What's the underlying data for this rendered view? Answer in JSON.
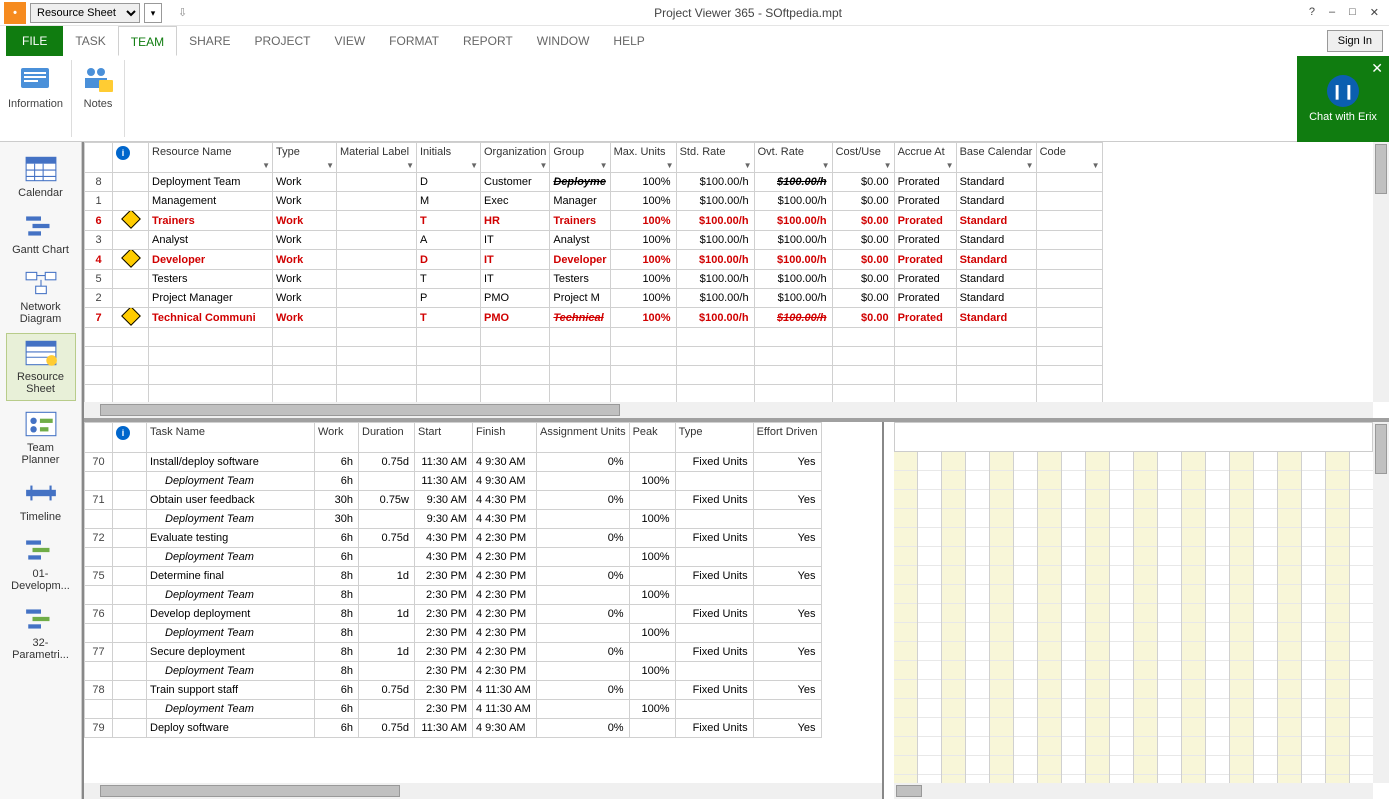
{
  "titlebar": {
    "dropdown": "Resource Sheet",
    "title": "Project Viewer 365 - SOftpedia.mpt",
    "help": "?",
    "min": "–",
    "max": "□",
    "close": "✕"
  },
  "tabs": [
    "FILE",
    "TASK",
    "TEAM",
    "SHARE",
    "PROJECT",
    "VIEW",
    "FORMAT",
    "REPORT",
    "WINDOW",
    "HELP"
  ],
  "signin": "Sign In",
  "ribbon": {
    "information": "Information",
    "notes": "Notes"
  },
  "chat": {
    "label": "Chat with Erix",
    "close": "✕",
    "face": "❙❙"
  },
  "sidebar": [
    {
      "id": "calendar",
      "label": "Calendar"
    },
    {
      "id": "gantt",
      "label": "Gantt Chart"
    },
    {
      "id": "network",
      "label": "Network Diagram"
    },
    {
      "id": "resource",
      "label": "Resource Sheet",
      "sel": true
    },
    {
      "id": "team",
      "label": "Team Planner"
    },
    {
      "id": "timeline",
      "label": "Timeline"
    },
    {
      "id": "dev",
      "label": "01-Developm..."
    },
    {
      "id": "param",
      "label": "32-Parametri..."
    }
  ],
  "resCols": [
    "",
    "",
    "Resource Name",
    "Type",
    "Material Label",
    "Initials",
    "Organization",
    "Group",
    "Max. Units",
    "Std. Rate",
    "Ovt. Rate",
    "Cost/Use",
    "Accrue At",
    "Base Calendar",
    "Code"
  ],
  "resources": [
    {
      "row": "8",
      "ind": "",
      "name": "Deployment Team",
      "type": "Work",
      "mat": "",
      "init": "D",
      "org": "Customer",
      "group": "Deployme",
      "grpStrike": true,
      "max": "100%",
      "std": "$100.00/h",
      "ovt": "$100.00/h",
      "ovtStrike": true,
      "cost": "$0.00",
      "acc": "Prorated",
      "cal": "Standard",
      "red": false
    },
    {
      "row": "1",
      "ind": "",
      "name": "Management",
      "type": "Work",
      "mat": "",
      "init": "M",
      "org": "Exec",
      "group": "Manager",
      "max": "100%",
      "std": "$100.00/h",
      "ovt": "$100.00/h",
      "cost": "$0.00",
      "acc": "Prorated",
      "cal": "Standard",
      "red": false
    },
    {
      "row": "6",
      "ind": "y",
      "name": "Trainers",
      "type": "Work",
      "mat": "",
      "init": "T",
      "org": "HR",
      "group": "Trainers",
      "max": "100%",
      "std": "$100.00/h",
      "ovt": "$100.00/h",
      "cost": "$0.00",
      "acc": "Prorated",
      "cal": "Standard",
      "red": true
    },
    {
      "row": "3",
      "ind": "",
      "name": "Analyst",
      "type": "Work",
      "mat": "",
      "init": "A",
      "org": "IT",
      "group": "Analyst",
      "max": "100%",
      "std": "$100.00/h",
      "ovt": "$100.00/h",
      "cost": "$0.00",
      "acc": "Prorated",
      "cal": "Standard",
      "red": false
    },
    {
      "row": "4",
      "ind": "y",
      "name": "Developer",
      "type": "Work",
      "mat": "",
      "init": "D",
      "org": "IT",
      "group": "Developer",
      "max": "100%",
      "std": "$100.00/h",
      "ovt": "$100.00/h",
      "cost": "$0.00",
      "acc": "Prorated",
      "cal": "Standard",
      "red": true
    },
    {
      "row": "5",
      "ind": "",
      "name": "Testers",
      "type": "Work",
      "mat": "",
      "init": "T",
      "org": "IT",
      "group": "Testers",
      "max": "100%",
      "std": "$100.00/h",
      "ovt": "$100.00/h",
      "cost": "$0.00",
      "acc": "Prorated",
      "cal": "Standard",
      "red": false
    },
    {
      "row": "2",
      "ind": "",
      "name": "Project Manager",
      "type": "Work",
      "mat": "",
      "init": "P",
      "org": "PMO",
      "group": "Project M",
      "max": "100%",
      "std": "$100.00/h",
      "ovt": "$100.00/h",
      "cost": "$0.00",
      "acc": "Prorated",
      "cal": "Standard",
      "red": false
    },
    {
      "row": "7",
      "ind": "y",
      "name": "Technical Communi",
      "type": "Work",
      "mat": "",
      "init": "T",
      "org": "PMO",
      "group": "Technical",
      "grpStrike": true,
      "max": "100%",
      "std": "$100.00/h",
      "ovt": "$100.00/h",
      "ovtStrike": true,
      "cost": "$0.00",
      "acc": "Prorated",
      "cal": "Standard",
      "red": true
    }
  ],
  "taskCols": [
    "",
    "",
    "Task Name",
    "Work",
    "Duration",
    "Start",
    "Finish",
    "Assignment Units",
    "Peak",
    "Type",
    "Effort Driven"
  ],
  "tasks": [
    {
      "row": "70",
      "name": "Install/deploy software",
      "work": "6h",
      "dur": "0.75d",
      "start": "11:30 AM",
      "finish": "4 9:30 AM",
      "au": "0%",
      "peak": "",
      "type": "Fixed Units",
      "eff": "Yes"
    },
    {
      "sub": true,
      "name": "Deployment Team",
      "work": "6h",
      "dur": "",
      "start": "11:30 AM",
      "finish": "4 9:30 AM",
      "au": "",
      "peak": "100%",
      "type": "",
      "eff": ""
    },
    {
      "row": "71",
      "name": "Obtain user feedback",
      "work": "30h",
      "dur": "0.75w",
      "start": "9:30 AM",
      "finish": "4 4:30 PM",
      "au": "0%",
      "peak": "",
      "type": "Fixed Units",
      "eff": "Yes"
    },
    {
      "sub": true,
      "name": "Deployment Team",
      "work": "30h",
      "dur": "",
      "start": "9:30 AM",
      "finish": "4 4:30 PM",
      "au": "",
      "peak": "100%",
      "type": "",
      "eff": ""
    },
    {
      "row": "72",
      "name": "Evaluate testing",
      "work": "6h",
      "dur": "0.75d",
      "start": "4:30 PM",
      "finish": "4 2:30 PM",
      "au": "0%",
      "peak": "",
      "type": "Fixed Units",
      "eff": "Yes"
    },
    {
      "sub": true,
      "name": "Deployment Team",
      "work": "6h",
      "dur": "",
      "start": "4:30 PM",
      "finish": "4 2:30 PM",
      "au": "",
      "peak": "100%",
      "type": "",
      "eff": ""
    },
    {
      "row": "75",
      "name": "Determine final",
      "work": "8h",
      "dur": "1d",
      "start": "2:30 PM",
      "finish": "4 2:30 PM",
      "au": "0%",
      "peak": "",
      "type": "Fixed Units",
      "eff": "Yes"
    },
    {
      "sub": true,
      "name": "Deployment Team",
      "work": "8h",
      "dur": "",
      "start": "2:30 PM",
      "finish": "4 2:30 PM",
      "au": "",
      "peak": "100%",
      "type": "",
      "eff": ""
    },
    {
      "row": "76",
      "name": "Develop deployment",
      "work": "8h",
      "dur": "1d",
      "start": "2:30 PM",
      "finish": "4 2:30 PM",
      "au": "0%",
      "peak": "",
      "type": "Fixed Units",
      "eff": "Yes"
    },
    {
      "sub": true,
      "name": "Deployment Team",
      "work": "8h",
      "dur": "",
      "start": "2:30 PM",
      "finish": "4 2:30 PM",
      "au": "",
      "peak": "100%",
      "type": "",
      "eff": ""
    },
    {
      "row": "77",
      "name": "Secure deployment",
      "work": "8h",
      "dur": "1d",
      "start": "2:30 PM",
      "finish": "4 2:30 PM",
      "au": "0%",
      "peak": "",
      "type": "Fixed Units",
      "eff": "Yes"
    },
    {
      "sub": true,
      "name": "Deployment Team",
      "work": "8h",
      "dur": "",
      "start": "2:30 PM",
      "finish": "4 2:30 PM",
      "au": "",
      "peak": "100%",
      "type": "",
      "eff": ""
    },
    {
      "row": "78",
      "name": "Train support staff",
      "work": "6h",
      "dur": "0.75d",
      "start": "2:30 PM",
      "finish": "4 11:30 AM",
      "au": "0%",
      "peak": "",
      "type": "Fixed Units",
      "eff": "Yes"
    },
    {
      "sub": true,
      "name": "Deployment Team",
      "work": "6h",
      "dur": "",
      "start": "2:30 PM",
      "finish": "4 11:30 AM",
      "au": "",
      "peak": "100%",
      "type": "",
      "eff": ""
    },
    {
      "row": "79",
      "name": "Deploy software",
      "work": "6h",
      "dur": "0.75d",
      "start": "11:30 AM",
      "finish": "4 9:30 AM",
      "au": "0%",
      "peak": "",
      "type": "Fixed Units",
      "eff": "Yes"
    }
  ]
}
